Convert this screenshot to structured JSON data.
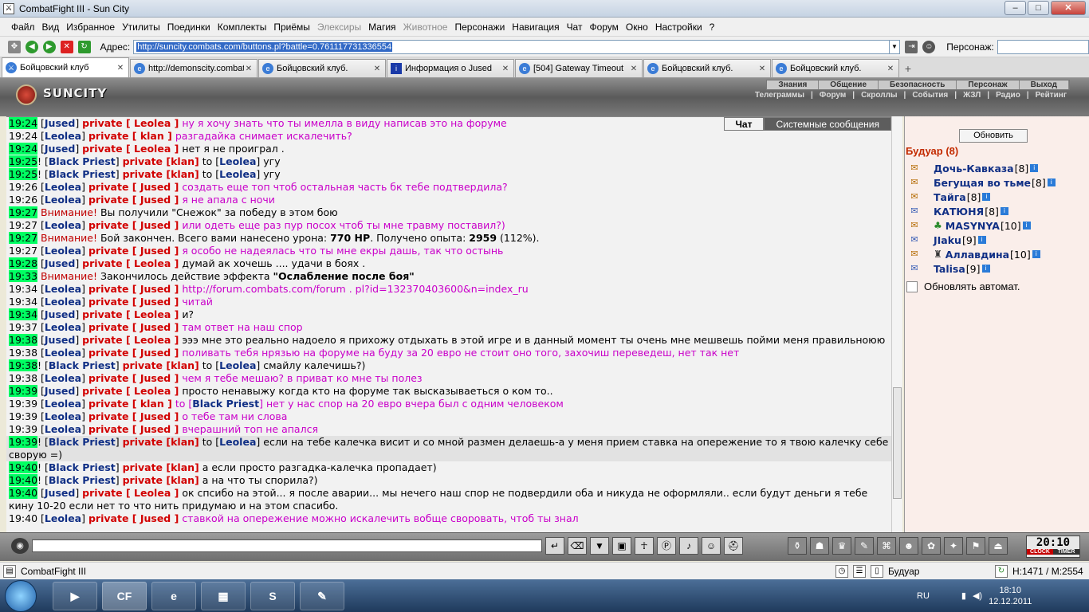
{
  "window": {
    "title": "CombatFight III - Sun City"
  },
  "menu": [
    "Файл",
    "Вид",
    "Избранное",
    "Утилиты",
    "Поединки",
    "Комплекты",
    "Приёмы",
    "Элексиры",
    "Магия",
    "Животное",
    "Персонажи",
    "Навигация",
    "Чат",
    "Форум",
    "Окно",
    "Настройки",
    "?"
  ],
  "address": {
    "label": "Адрес:",
    "url": "http://suncity.combats.com/buttons.pl?battle=0.761117731336554",
    "persona_label": "Персонаж:"
  },
  "tabs": [
    {
      "label": "Бойцовский клуб"
    },
    {
      "label": "http://demonscity.combats.com/showi..."
    },
    {
      "label": "Бойцовский клуб."
    },
    {
      "label": "Информация о Jused"
    },
    {
      "label": "[504] Gateway Timeout"
    },
    {
      "label": "Бойцовский клуб."
    },
    {
      "label": "Бойцовский клуб."
    }
  ],
  "game": {
    "logo": "SUNCITY",
    "nav_top": [
      "Знания",
      "Общение",
      "Безопасность",
      "Персонаж",
      "Выход"
    ],
    "nav_sub": [
      "Телеграммы",
      "|",
      "Форум",
      "|",
      "Скроллы",
      "|",
      "События",
      "|",
      "ЖЗЛ",
      "|",
      "Радио",
      "|",
      "Рейтинг"
    ]
  },
  "chat_tabs": {
    "chat": "Чат",
    "system": "Системные сообщения"
  },
  "chat": {
    "l1": {
      "ts": "19:24",
      "from": "Jused",
      "priv": "private [ Leolea ]",
      "msg": "ну я хочу знать что ты имелла в виду написав это на форуме"
    },
    "l2": {
      "ts": "19:24",
      "from": "Leolea",
      "priv": "private [ klan ]",
      "msg": "разгадайка снимает искалечить?"
    },
    "l3": {
      "ts": "19:24",
      "from": "Jused",
      "priv": "private [ Leolea ]",
      "msg": "нет я не проиграл ."
    },
    "l4": {
      "ts": "19:25",
      "from": "Black Priest",
      "priv": "private [klan]",
      "to_word": "to",
      "to": "Leolea",
      "msg": "угу"
    },
    "l5": {
      "ts": "19:25",
      "from": "Black Priest",
      "priv": "private [klan]",
      "to_word": "to",
      "to": "Leolea",
      "msg": "угу"
    },
    "l6": {
      "ts": "19:26",
      "from": "Leolea",
      "priv": "private [ Jused ]",
      "msg": "создать еще топ чтоб остальная часть бк тебе подтвердила?"
    },
    "l7": {
      "ts": "19:26",
      "from": "Leolea",
      "priv": "private [ Jused ]",
      "msg": "я не апала с ночи"
    },
    "l8": {
      "ts": "19:27",
      "warn": "Внимание!",
      "msg": "Вы получили \"Снежок\" за победу в этом бою"
    },
    "l9": {
      "ts": "19:27",
      "from": "Leolea",
      "priv": "private [ Jused ]",
      "msg": "или одеть еще раз пур посох чтоб ты мне травму поставил?)"
    },
    "l10": {
      "ts": "19:27",
      "warn": "Внимание!",
      "msg_a": "Бой закончен. Всего вами нанесено урона:",
      "val_a": "770 HP",
      "msg_b": ". Получено опыта:",
      "val_b": "2959",
      "msg_c": "(112%)."
    },
    "l11": {
      "ts": "19:27",
      "from": "Leolea",
      "priv": "private [ Jused ]",
      "msg": "я особо не надеялась что ты мне екры дашь, так что остынь"
    },
    "l12": {
      "ts": "19:28",
      "from": "Jused",
      "priv": "private [ Leolea ]",
      "msg": "думай ак хочешь .... удачи в боях ."
    },
    "l13": {
      "ts": "19:33",
      "warn": "Внимание!",
      "msg": "Закончилось действие эффекта",
      "effect": "\"Ослабление после боя\""
    },
    "l14": {
      "ts": "19:34",
      "from": "Leolea",
      "priv": "private [ Jused ]",
      "msg": "http://forum.combats.com/forum . pl?id=132370403600&n=index_ru"
    },
    "l15": {
      "ts": "19:34",
      "from": "Leolea",
      "priv": "private [ Jused ]",
      "msg": "читай"
    },
    "l16": {
      "ts": "19:34",
      "from": "Jused",
      "priv": "private [ Leolea ]",
      "msg": "и?"
    },
    "l17": {
      "ts": "19:37",
      "from": "Leolea",
      "priv": "private [ Jused ]",
      "msg": "там ответ на наш спор"
    },
    "l18": {
      "ts": "19:38",
      "from": "Jused",
      "priv": "private [ Leolea ]",
      "msg": "эээ мне это реально надоело я прихожу отдыхать в этой игре и в данный момент ты очень мне мешвешь пойми меня правильноюю"
    },
    "l19": {
      "ts": "19:38",
      "from": "Leolea",
      "priv": "private [ Jused ]",
      "msg": "поливать тебя нрязью на форуме на буду за 20 евро не стоит оно того, захочиш переведеш, нет так нет"
    },
    "l20": {
      "ts": "19:38",
      "from": "Black Priest",
      "priv": "private [klan]",
      "to_word": "to",
      "to": "Leolea",
      "msg": "смайлу калечишь?)"
    },
    "l21": {
      "ts": "19:38",
      "from": "Leolea",
      "priv": "private [ Jused ]",
      "msg": "чем я тебе мешаю? в приват ко мне ты полез"
    },
    "l22": {
      "ts": "19:39",
      "from": "Jused",
      "priv": "private [ Leolea ]",
      "msg": "просто ненавыжу когда кто на форуме так высказываеться о ком то.."
    },
    "l23": {
      "ts": "19:39",
      "from": "Leolea",
      "priv": "private [ klan ]",
      "to_word": "to",
      "to": "Black Priest",
      "msg": "нет у нас спор на 20 евро вчера был с одним человеком"
    },
    "l24": {
      "ts": "19:39",
      "from": "Leolea",
      "priv": "private [ Jused ]",
      "msg": "о тебе там ни слова"
    },
    "l25": {
      "ts": "19:39",
      "from": "Leolea",
      "priv": "private [ Jused ]",
      "msg": "вчерашний топ не апался"
    },
    "l26": {
      "ts": "19:39",
      "from": "Black Priest",
      "priv": "private [klan]",
      "to_word": "to",
      "to": "Leolea",
      "msg": "если на тебе калечка висит и со мной размен делаешь-а у меня прием ставка на опережение то я твою калечку себе сворую =)"
    },
    "l27": {
      "ts": "19:40",
      "from": "Black Priest",
      "priv": "private [klan]",
      "msg": "а если просто разгадка-калечка пропадает)"
    },
    "l28": {
      "ts": "19:40",
      "from": "Black Priest",
      "priv": "private [klan]",
      "msg": "а на что ты спорила?)"
    },
    "l29": {
      "ts": "19:40",
      "from": "Jused",
      "priv": "private [ Leolea ]",
      "msg": "ок спсибо на этой... я после аварии... мы нечего наш спор не подвердили оба и никуда не оформляли.. если будут деньги я тебе кину 10-20 если нет то что нить придумаю и на этом спасибо."
    },
    "l30": {
      "ts": "19:40",
      "from": "Leolea",
      "priv": "private [ Jused ]",
      "msg": "ставкой на опережение можно искалечить вобще своровать, чтоб ты знал"
    }
  },
  "side": {
    "refresh": "Обновить",
    "room": "Будуар (8)",
    "users": [
      {
        "name": "Дочь-Кавказа",
        "level": "[8]"
      },
      {
        "name": "Бегущая во тьме",
        "level": "[8]"
      },
      {
        "name": "Тайга",
        "level": "[8]"
      },
      {
        "name": "КАТЮНЯ",
        "level": "[8]"
      },
      {
        "name": "MASYNYA",
        "level": "[10]"
      },
      {
        "name": "JIaku",
        "level": "[9]"
      },
      {
        "name": "Аллавдина",
        "level": "[10]"
      },
      {
        "name": "Talisa",
        "level": "[9]"
      }
    ],
    "auto_refresh": "Обновлять автомат."
  },
  "clock": {
    "time": "20:10",
    "clock_label": "CLOCK",
    "timer_label": "TIMER"
  },
  "status": {
    "app": "CombatFight III",
    "room": "Будуар",
    "hp_mana": "H:1471 / M:2554"
  },
  "taskbar": {
    "lang": "RU",
    "time": "18:10",
    "date": "12.12.2011"
  }
}
